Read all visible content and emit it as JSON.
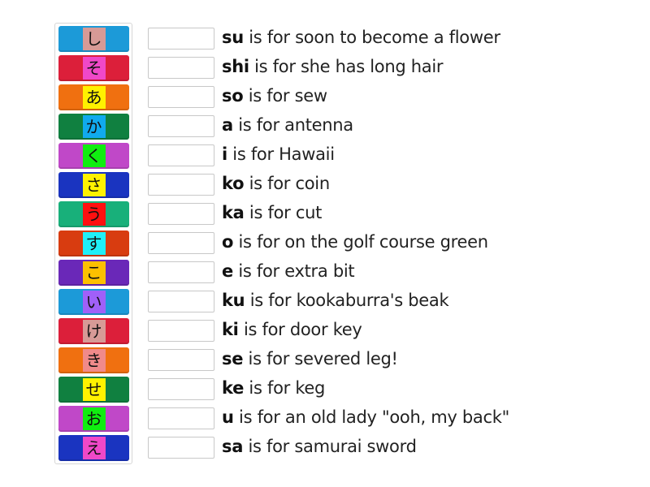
{
  "tiles": [
    {
      "kana": "し",
      "bg": "#1c9ad8",
      "hl": "#d79a96"
    },
    {
      "kana": "そ",
      "bg": "#dc1f3a",
      "hl": "#f048c8"
    },
    {
      "kana": "あ",
      "bg": "#f07010",
      "hl": "#fff200"
    },
    {
      "kana": "か",
      "bg": "#108040",
      "hl": "#10aaee"
    },
    {
      "kana": "く",
      "bg": "#c048c8",
      "hl": "#10ee10"
    },
    {
      "kana": "さ",
      "bg": "#1a34c0",
      "hl": "#fff200"
    },
    {
      "kana": "う",
      "bg": "#18b07a",
      "hl": "#ff1010"
    },
    {
      "kana": "す",
      "bg": "#d83c10",
      "hl": "#20f0f8"
    },
    {
      "kana": "こ",
      "bg": "#6a28b8",
      "hl": "#fcc000"
    },
    {
      "kana": "い",
      "bg": "#1c9ad8",
      "hl": "#a060f8"
    },
    {
      "kana": "け",
      "bg": "#dc1f3a",
      "hl": "#d79a96"
    },
    {
      "kana": "き",
      "bg": "#f07010",
      "hl": "#f08a8a"
    },
    {
      "kana": "せ",
      "bg": "#108040",
      "hl": "#fff200"
    },
    {
      "kana": "お",
      "bg": "#c048c8",
      "hl": "#10ee10"
    },
    {
      "kana": "え",
      "bg": "#1a34c0",
      "hl": "#f048c8"
    }
  ],
  "clues": [
    {
      "key": "su",
      "text": " is for soon to become a flower"
    },
    {
      "key": "shi",
      "text": " is for she has long hair"
    },
    {
      "key": "so",
      "text": " is for sew"
    },
    {
      "key": "a",
      "text": " is for antenna"
    },
    {
      "key": "i",
      "text": " is for Hawaii"
    },
    {
      "key": "ko",
      "text": " is for coin"
    },
    {
      "key": "ka",
      "text": " is for cut"
    },
    {
      "key": "o",
      "text": " is for on the golf course green"
    },
    {
      "key": "e",
      "text": " is for extra bit"
    },
    {
      "key": "ku",
      "text": " is for kookaburra's beak"
    },
    {
      "key": "ki",
      "text": " is for door key"
    },
    {
      "key": "se",
      "text": " is for severed leg!"
    },
    {
      "key": "ke",
      "text": " is for keg"
    },
    {
      "key": "u",
      "text": " is for an old lady \"ooh, my back\""
    },
    {
      "key": "sa",
      "text": " is for samurai sword"
    }
  ]
}
